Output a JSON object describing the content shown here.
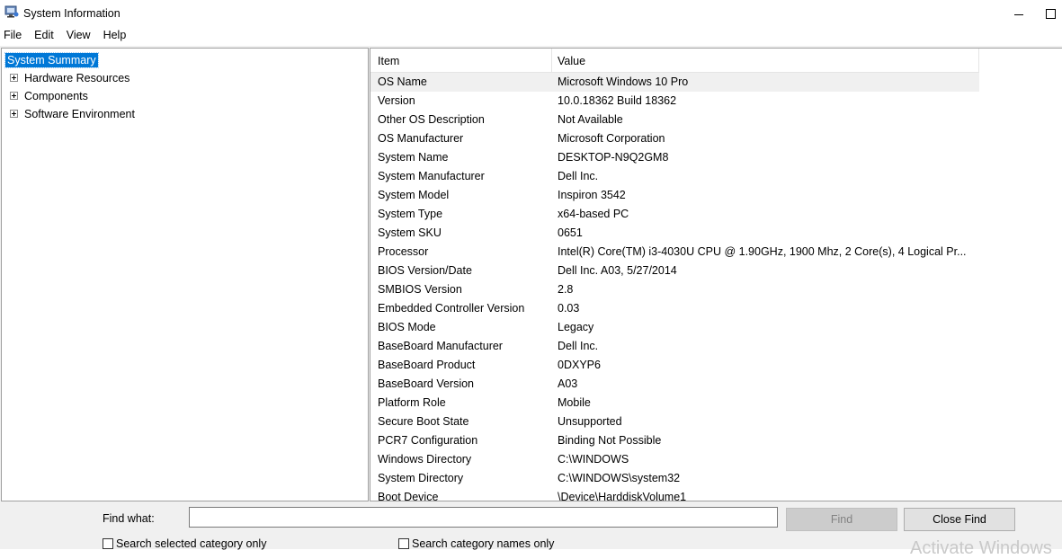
{
  "window": {
    "title": "System Information"
  },
  "menu": [
    "File",
    "Edit",
    "View",
    "Help"
  ],
  "tree": {
    "items": [
      {
        "label": "System Summary",
        "selected": true,
        "expandable": false
      },
      {
        "label": "Hardware Resources",
        "selected": false,
        "expandable": true
      },
      {
        "label": "Components",
        "selected": false,
        "expandable": true
      },
      {
        "label": "Software Environment",
        "selected": false,
        "expandable": true
      }
    ]
  },
  "table": {
    "columns": {
      "item": "Item",
      "value": "Value"
    },
    "rows": [
      {
        "item": "OS Name",
        "value": "Microsoft Windows 10 Pro"
      },
      {
        "item": "Version",
        "value": "10.0.18362 Build 18362"
      },
      {
        "item": "Other OS Description",
        "value": "Not Available"
      },
      {
        "item": "OS Manufacturer",
        "value": "Microsoft Corporation"
      },
      {
        "item": "System Name",
        "value": "DESKTOP-N9Q2GM8"
      },
      {
        "item": "System Manufacturer",
        "value": "Dell Inc."
      },
      {
        "item": "System Model",
        "value": "Inspiron 3542"
      },
      {
        "item": "System Type",
        "value": "x64-based PC"
      },
      {
        "item": "System SKU",
        "value": "0651"
      },
      {
        "item": "Processor",
        "value": "Intel(R) Core(TM) i3-4030U CPU @ 1.90GHz, 1900 Mhz, 2 Core(s), 4 Logical Pr..."
      },
      {
        "item": "BIOS Version/Date",
        "value": "Dell Inc. A03, 5/27/2014"
      },
      {
        "item": "SMBIOS Version",
        "value": "2.8"
      },
      {
        "item": "Embedded Controller Version",
        "value": "0.03"
      },
      {
        "item": "BIOS Mode",
        "value": "Legacy"
      },
      {
        "item": "BaseBoard Manufacturer",
        "value": "Dell Inc."
      },
      {
        "item": "BaseBoard Product",
        "value": "0DXYP6"
      },
      {
        "item": "BaseBoard Version",
        "value": "A03"
      },
      {
        "item": "Platform Role",
        "value": "Mobile"
      },
      {
        "item": "Secure Boot State",
        "value": "Unsupported"
      },
      {
        "item": "PCR7 Configuration",
        "value": "Binding Not Possible"
      },
      {
        "item": "Windows Directory",
        "value": "C:\\WINDOWS"
      },
      {
        "item": "System Directory",
        "value": "C:\\WINDOWS\\system32"
      },
      {
        "item": "Boot Device",
        "value": "\\Device\\HarddiskVolume1"
      }
    ]
  },
  "find": {
    "label": "Find what:",
    "value": "",
    "find_button": "Find",
    "close_button": "Close Find",
    "search_selected": "Search selected category only",
    "search_names": "Search category names only"
  },
  "watermark": "Activate Windows",
  "colors": {
    "selection": "#0078d7",
    "background": "#f0f0f0"
  }
}
